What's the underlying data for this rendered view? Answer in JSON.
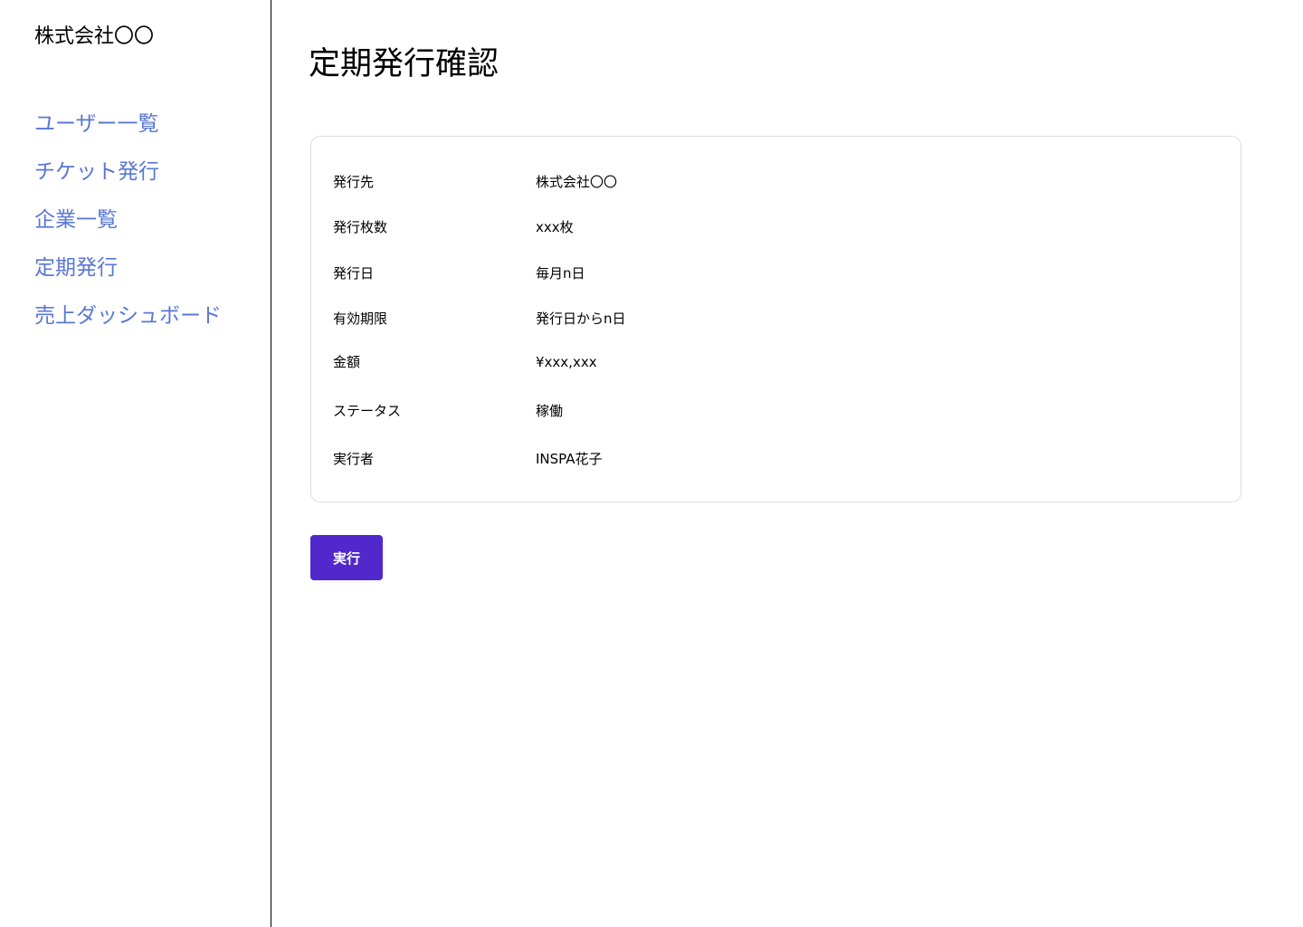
{
  "sidebar": {
    "company_name": "株式会社〇〇",
    "items": [
      {
        "label": "ユーザー一覧"
      },
      {
        "label": "チケット発行"
      },
      {
        "label": "企業一覧"
      },
      {
        "label": "定期発行"
      },
      {
        "label": "売上ダッシュボード"
      }
    ]
  },
  "main": {
    "title": "定期発行確認",
    "details": [
      {
        "label": "発行先",
        "value": "株式会社〇〇"
      },
      {
        "label": "発行枚数",
        "value": "xxx枚"
      },
      {
        "label": "発行日",
        "value": "毎月n日"
      },
      {
        "label": "有効期限",
        "value": "発行日からn日"
      },
      {
        "label": "金額",
        "value": "¥xxx,xxx"
      },
      {
        "label": "ステータス",
        "value": "稼働"
      },
      {
        "label": "実行者",
        "value": "INSPA花子"
      }
    ],
    "execute_label": "実行"
  },
  "colors": {
    "nav_link": "#5a77d4",
    "primary_button": "#5128cb",
    "card_border": "#dddddd",
    "divider": "#000000"
  }
}
